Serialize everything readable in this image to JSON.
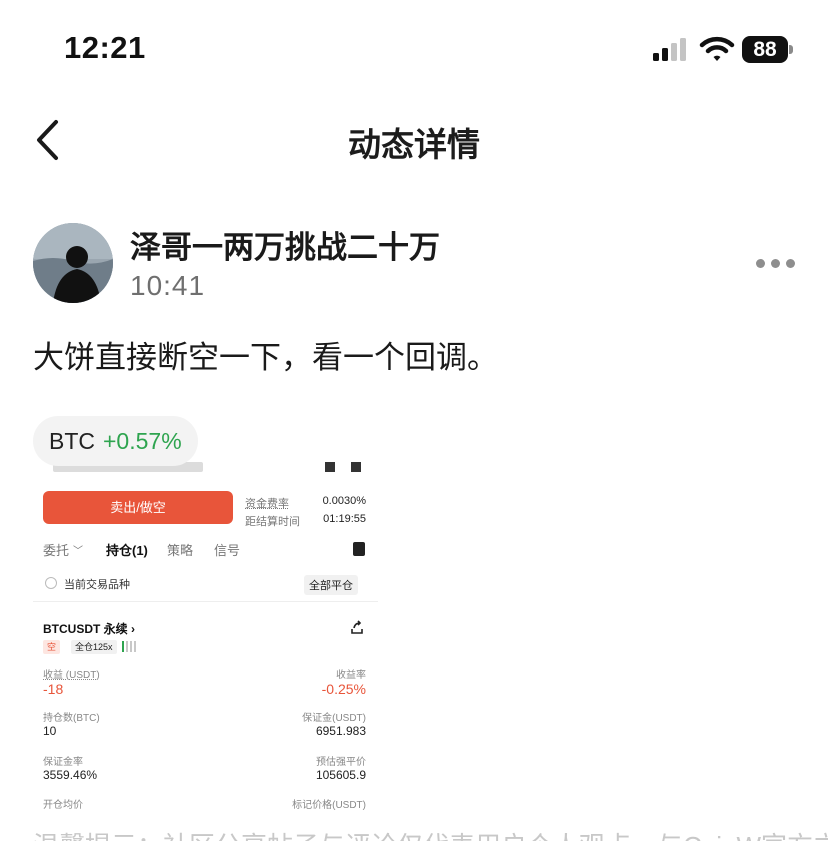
{
  "status_bar": {
    "time": "12:21",
    "battery": "88",
    "icons": [
      "signal-icon",
      "wifi-icon",
      "battery-icon"
    ]
  },
  "nav": {
    "title": "动态详情",
    "back_icon": "chevron-left-icon"
  },
  "post": {
    "author": "泽哥一两万挑战二十万",
    "time": "10:41",
    "text": "大饼直接断空一下，看一个回调。",
    "more_icon": "more-dots-icon",
    "ticker_chip": {
      "symbol": "BTC",
      "change": "+0.57%",
      "change_color": "#2ea44f"
    },
    "footer_text": "温馨提示：社区分享帖子与评论仅代表用户个人观点，与CoinW官方立"
  },
  "screenshot": {
    "sell_button": "卖出/做空",
    "funding_rate_label": "资金费率",
    "funding_rate_value": "0.0030%",
    "settlement_label": "距结算时间",
    "settlement_value": "01:19:55",
    "tabs": [
      "委托",
      "持仓(1)",
      "策略",
      "信号"
    ],
    "filter_label": "当前交易品种",
    "close_all": "全部平仓",
    "position": {
      "symbol": "BTCUSDT 永续",
      "side": "空",
      "leverage": "全仓125x",
      "pnl_label": "收益 (USDT)",
      "pnl_value": "-18",
      "roe_label": "收益率",
      "roe_value": "-0.25%",
      "size_label": "持仓数(BTC)",
      "size_value": "10",
      "margin_label": "保证金(USDT)",
      "margin_value": "6951.983",
      "margin_ratio_label": "保证金率",
      "margin_ratio_value": "3559.46%",
      "liq_price_label": "预估强平价",
      "liq_price_value": "105605.9",
      "entry_price_label": "开仓均价",
      "mark_price_label": "标记价格(USDT)"
    },
    "accent_color": "#e8553a"
  }
}
